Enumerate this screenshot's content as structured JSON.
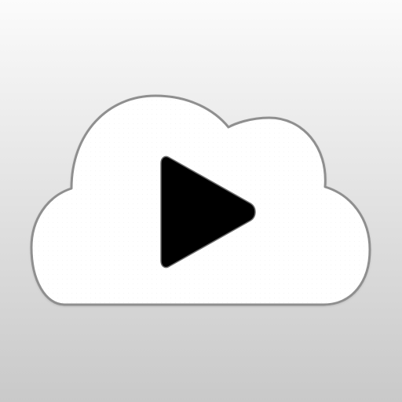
{
  "app_icon": {
    "icon": "cloud-play-icon",
    "colors": {
      "background_top": "#fbfbfb",
      "background_bottom": "#c9c9c9",
      "cloud_fill": "#ffffff",
      "cloud_stroke": "#8f8f8f",
      "play_fill": "#000000",
      "play_stroke": "#6b6b6b"
    },
    "components": {
      "cloud": "cloud-icon",
      "play": "play-icon"
    }
  }
}
